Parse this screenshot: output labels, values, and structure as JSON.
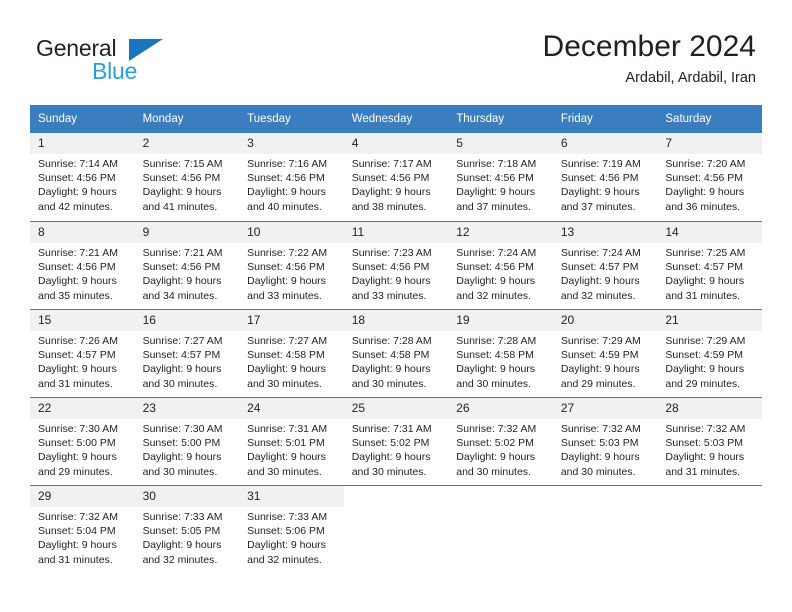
{
  "brand": {
    "line1": "General",
    "line2": "Blue",
    "triangle_color": "#1b75bb",
    "line2_color": "#2a9ddd"
  },
  "header": {
    "title": "December 2024",
    "subtitle": "Ardabil, Ardabil, Iran"
  },
  "theme": {
    "header_bg": "#3a7ebf",
    "header_text": "#ffffff",
    "daynum_bg": "#f1f1f1",
    "text": "#231f20"
  },
  "calendar": {
    "weekday_headers": [
      "Sunday",
      "Monday",
      "Tuesday",
      "Wednesday",
      "Thursday",
      "Friday",
      "Saturday"
    ],
    "weeks": [
      [
        {
          "day": "1",
          "sunrise": "Sunrise: 7:14 AM",
          "sunset": "Sunset: 4:56 PM",
          "daylight1": "Daylight: 9 hours",
          "daylight2": "and 42 minutes."
        },
        {
          "day": "2",
          "sunrise": "Sunrise: 7:15 AM",
          "sunset": "Sunset: 4:56 PM",
          "daylight1": "Daylight: 9 hours",
          "daylight2": "and 41 minutes."
        },
        {
          "day": "3",
          "sunrise": "Sunrise: 7:16 AM",
          "sunset": "Sunset: 4:56 PM",
          "daylight1": "Daylight: 9 hours",
          "daylight2": "and 40 minutes."
        },
        {
          "day": "4",
          "sunrise": "Sunrise: 7:17 AM",
          "sunset": "Sunset: 4:56 PM",
          "daylight1": "Daylight: 9 hours",
          "daylight2": "and 38 minutes."
        },
        {
          "day": "5",
          "sunrise": "Sunrise: 7:18 AM",
          "sunset": "Sunset: 4:56 PM",
          "daylight1": "Daylight: 9 hours",
          "daylight2": "and 37 minutes."
        },
        {
          "day": "6",
          "sunrise": "Sunrise: 7:19 AM",
          "sunset": "Sunset: 4:56 PM",
          "daylight1": "Daylight: 9 hours",
          "daylight2": "and 37 minutes."
        },
        {
          "day": "7",
          "sunrise": "Sunrise: 7:20 AM",
          "sunset": "Sunset: 4:56 PM",
          "daylight1": "Daylight: 9 hours",
          "daylight2": "and 36 minutes."
        }
      ],
      [
        {
          "day": "8",
          "sunrise": "Sunrise: 7:21 AM",
          "sunset": "Sunset: 4:56 PM",
          "daylight1": "Daylight: 9 hours",
          "daylight2": "and 35 minutes."
        },
        {
          "day": "9",
          "sunrise": "Sunrise: 7:21 AM",
          "sunset": "Sunset: 4:56 PM",
          "daylight1": "Daylight: 9 hours",
          "daylight2": "and 34 minutes."
        },
        {
          "day": "10",
          "sunrise": "Sunrise: 7:22 AM",
          "sunset": "Sunset: 4:56 PM",
          "daylight1": "Daylight: 9 hours",
          "daylight2": "and 33 minutes."
        },
        {
          "day": "11",
          "sunrise": "Sunrise: 7:23 AM",
          "sunset": "Sunset: 4:56 PM",
          "daylight1": "Daylight: 9 hours",
          "daylight2": "and 33 minutes."
        },
        {
          "day": "12",
          "sunrise": "Sunrise: 7:24 AM",
          "sunset": "Sunset: 4:56 PM",
          "daylight1": "Daylight: 9 hours",
          "daylight2": "and 32 minutes."
        },
        {
          "day": "13",
          "sunrise": "Sunrise: 7:24 AM",
          "sunset": "Sunset: 4:57 PM",
          "daylight1": "Daylight: 9 hours",
          "daylight2": "and 32 minutes."
        },
        {
          "day": "14",
          "sunrise": "Sunrise: 7:25 AM",
          "sunset": "Sunset: 4:57 PM",
          "daylight1": "Daylight: 9 hours",
          "daylight2": "and 31 minutes."
        }
      ],
      [
        {
          "day": "15",
          "sunrise": "Sunrise: 7:26 AM",
          "sunset": "Sunset: 4:57 PM",
          "daylight1": "Daylight: 9 hours",
          "daylight2": "and 31 minutes."
        },
        {
          "day": "16",
          "sunrise": "Sunrise: 7:27 AM",
          "sunset": "Sunset: 4:57 PM",
          "daylight1": "Daylight: 9 hours",
          "daylight2": "and 30 minutes."
        },
        {
          "day": "17",
          "sunrise": "Sunrise: 7:27 AM",
          "sunset": "Sunset: 4:58 PM",
          "daylight1": "Daylight: 9 hours",
          "daylight2": "and 30 minutes."
        },
        {
          "day": "18",
          "sunrise": "Sunrise: 7:28 AM",
          "sunset": "Sunset: 4:58 PM",
          "daylight1": "Daylight: 9 hours",
          "daylight2": "and 30 minutes."
        },
        {
          "day": "19",
          "sunrise": "Sunrise: 7:28 AM",
          "sunset": "Sunset: 4:58 PM",
          "daylight1": "Daylight: 9 hours",
          "daylight2": "and 30 minutes."
        },
        {
          "day": "20",
          "sunrise": "Sunrise: 7:29 AM",
          "sunset": "Sunset: 4:59 PM",
          "daylight1": "Daylight: 9 hours",
          "daylight2": "and 29 minutes."
        },
        {
          "day": "21",
          "sunrise": "Sunrise: 7:29 AM",
          "sunset": "Sunset: 4:59 PM",
          "daylight1": "Daylight: 9 hours",
          "daylight2": "and 29 minutes."
        }
      ],
      [
        {
          "day": "22",
          "sunrise": "Sunrise: 7:30 AM",
          "sunset": "Sunset: 5:00 PM",
          "daylight1": "Daylight: 9 hours",
          "daylight2": "and 29 minutes."
        },
        {
          "day": "23",
          "sunrise": "Sunrise: 7:30 AM",
          "sunset": "Sunset: 5:00 PM",
          "daylight1": "Daylight: 9 hours",
          "daylight2": "and 30 minutes."
        },
        {
          "day": "24",
          "sunrise": "Sunrise: 7:31 AM",
          "sunset": "Sunset: 5:01 PM",
          "daylight1": "Daylight: 9 hours",
          "daylight2": "and 30 minutes."
        },
        {
          "day": "25",
          "sunrise": "Sunrise: 7:31 AM",
          "sunset": "Sunset: 5:02 PM",
          "daylight1": "Daylight: 9 hours",
          "daylight2": "and 30 minutes."
        },
        {
          "day": "26",
          "sunrise": "Sunrise: 7:32 AM",
          "sunset": "Sunset: 5:02 PM",
          "daylight1": "Daylight: 9 hours",
          "daylight2": "and 30 minutes."
        },
        {
          "day": "27",
          "sunrise": "Sunrise: 7:32 AM",
          "sunset": "Sunset: 5:03 PM",
          "daylight1": "Daylight: 9 hours",
          "daylight2": "and 30 minutes."
        },
        {
          "day": "28",
          "sunrise": "Sunrise: 7:32 AM",
          "sunset": "Sunset: 5:03 PM",
          "daylight1": "Daylight: 9 hours",
          "daylight2": "and 31 minutes."
        }
      ],
      [
        {
          "day": "29",
          "sunrise": "Sunrise: 7:32 AM",
          "sunset": "Sunset: 5:04 PM",
          "daylight1": "Daylight: 9 hours",
          "daylight2": "and 31 minutes."
        },
        {
          "day": "30",
          "sunrise": "Sunrise: 7:33 AM",
          "sunset": "Sunset: 5:05 PM",
          "daylight1": "Daylight: 9 hours",
          "daylight2": "and 32 minutes."
        },
        {
          "day": "31",
          "sunrise": "Sunrise: 7:33 AM",
          "sunset": "Sunset: 5:06 PM",
          "daylight1": "Daylight: 9 hours",
          "daylight2": "and 32 minutes."
        },
        {
          "day": "",
          "sunrise": "",
          "sunset": "",
          "daylight1": "",
          "daylight2": ""
        },
        {
          "day": "",
          "sunrise": "",
          "sunset": "",
          "daylight1": "",
          "daylight2": ""
        },
        {
          "day": "",
          "sunrise": "",
          "sunset": "",
          "daylight1": "",
          "daylight2": ""
        },
        {
          "day": "",
          "sunrise": "",
          "sunset": "",
          "daylight1": "",
          "daylight2": ""
        }
      ]
    ]
  }
}
